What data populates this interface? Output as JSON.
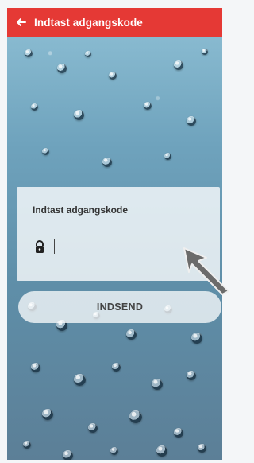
{
  "header": {
    "title": "Indtast adgangskode",
    "back_icon": "arrow-left-icon",
    "background_color": "#e53935"
  },
  "password_card": {
    "label": "Indtast adgangskode",
    "lock_icon": "lock-icon",
    "input_value": "",
    "placeholder": ""
  },
  "actions": {
    "submit_label": "INDSEND"
  },
  "annotation": {
    "arrow_icon": "pointer-arrow-icon",
    "arrow_color": "#6b6b6b"
  }
}
